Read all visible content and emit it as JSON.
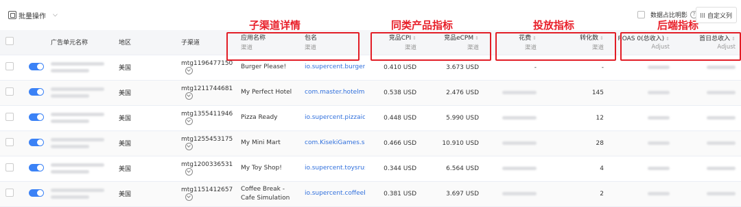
{
  "toolbar": {
    "batch_label": "批量操作",
    "ratio_toggle_label": "数据占比明影",
    "custom_cols_label": "自定义列"
  },
  "sections": {
    "subchannel": "子渠道详情",
    "similar": "同类产品指标",
    "delivery": "投放指标",
    "backend": "后端指标"
  },
  "columns": {
    "ad_unit": "广告单元名称",
    "region": "地区",
    "subchannel": "子渠道",
    "app_name": "应用名称",
    "app_name_sub": "渠道",
    "package": "包名",
    "package_sub": "渠道",
    "cpi": "竞品CPI",
    "cpi_sub": "渠道",
    "ecpm": "竞品eCPM",
    "ecpm_sub": "渠道",
    "spend": "花费",
    "spend_sub": "渠道",
    "conv": "转化数",
    "conv_sub": "渠道",
    "roas": "ROAS 0(总收入)",
    "roas_sub": "Adjust",
    "d1rev": "首日总收入",
    "d1rev_sub": "Adjust"
  },
  "rows": [
    {
      "region": "美国",
      "subchannel": "mtg1196477150",
      "app": "Burger Please!",
      "package": "io.supercent.burgeridle",
      "cpi": "0.410 USD",
      "ecpm": "3.673 USD",
      "conv": "-",
      "spend": "-"
    },
    {
      "region": "美国",
      "subchannel": "mtg1211744681",
      "app": "My Perfect Hotel",
      "package": "com.master.hotelmaster",
      "cpi": "0.538 USD",
      "ecpm": "2.476 USD",
      "conv": "145",
      "spend": ""
    },
    {
      "region": "美国",
      "subchannel": "mtg1355411946",
      "app": "Pizza Ready",
      "package": "io.supercent.pizzaidle",
      "cpi": "0.448 USD",
      "ecpm": "5.990 USD",
      "conv": "12",
      "spend": ""
    },
    {
      "region": "美国",
      "subchannel": "mtg1255453175",
      "app": "My Mini Mart",
      "package": "com.KisekiGames.smart",
      "cpi": "0.466 USD",
      "ecpm": "10.910 USD",
      "conv": "28",
      "spend": ""
    },
    {
      "region": "美国",
      "subchannel": "mtg1200336531",
      "app": "My Toy Shop!",
      "package": "io.supercent.toysrus",
      "cpi": "0.344 USD",
      "ecpm": "6.564 USD",
      "conv": "4",
      "spend": ""
    },
    {
      "region": "美国",
      "subchannel": "mtg1151412657",
      "app": "Coffee Break - Cafe Simulation",
      "package": "io.supercent.coffeebreak",
      "cpi": "0.381 USD",
      "ecpm": "3.697 USD",
      "conv": "2",
      "spend": ""
    }
  ]
}
